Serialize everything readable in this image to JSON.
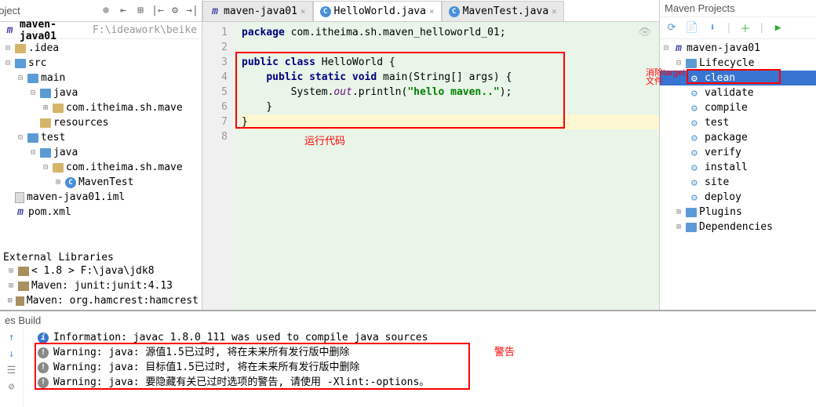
{
  "breadcrumb": {
    "project": "maven-java01",
    "path": "F:\\ideawork\\beike"
  },
  "toolbar": {
    "label": "oject"
  },
  "tree": [
    {
      "indent": 0,
      "exp": "⊟",
      "icon": "folder",
      "label": ".idea"
    },
    {
      "indent": 0,
      "exp": "⊟",
      "icon": "folder-blue",
      "label": "src"
    },
    {
      "indent": 1,
      "exp": "⊟",
      "icon": "folder-blue",
      "label": "main"
    },
    {
      "indent": 2,
      "exp": "⊟",
      "icon": "folder-blue",
      "label": "java"
    },
    {
      "indent": 3,
      "exp": "⊞",
      "icon": "folder",
      "label": "com.itheima.sh.mave"
    },
    {
      "indent": 2,
      "exp": "",
      "icon": "folder",
      "label": "resources"
    },
    {
      "indent": 1,
      "exp": "⊟",
      "icon": "folder-blue",
      "label": "test"
    },
    {
      "indent": 2,
      "exp": "⊟",
      "icon": "folder-blue",
      "label": "java"
    },
    {
      "indent": 3,
      "exp": "⊟",
      "icon": "folder",
      "label": "com.itheima.sh.mave"
    },
    {
      "indent": 4,
      "exp": "⊞",
      "icon": "java",
      "label": "MavenTest"
    },
    {
      "indent": 0,
      "exp": "",
      "icon": "file",
      "label": "maven-java01.iml"
    },
    {
      "indent": 0,
      "exp": "",
      "icon": "m",
      "label": "pom.xml"
    }
  ],
  "external_libs": {
    "title": "External Libraries",
    "items": [
      "< 1.8 >   F:\\java\\jdk8",
      "Maven: junit:junit:4.13",
      "Maven: org.hamcrest:hamcrest"
    ]
  },
  "tabs": [
    {
      "icon": "m",
      "label": "maven-java01",
      "active": false
    },
    {
      "icon": "java",
      "label": "HelloWorld.java",
      "active": true
    },
    {
      "icon": "java",
      "label": "MavenTest.java",
      "active": false
    }
  ],
  "code": {
    "lines": [
      "1",
      "2",
      "3",
      "4",
      "5",
      "6",
      "7",
      "8"
    ],
    "l1_kw": "package",
    "l1_rest": " com.itheima.sh.maven_helloworld_01;",
    "l3_kw": "public class",
    "l3_cls": " HelloWorld ",
    "l3_brace": "{",
    "l4_kw": "public static void",
    "l4_rest": " main(String[] args) {",
    "l5_pre": "        System.",
    "l5_field": "out",
    "l5_mid": ".println(",
    "l5_str": "\"hello maven..\"",
    "l5_end": ");",
    "l6": "    }",
    "l7": "}"
  },
  "annotations": {
    "run_code": "运行代码",
    "warning": "警告",
    "clean_note": "消除target文件"
  },
  "right_panel": {
    "title": "Maven Projects",
    "project": "maven-java01",
    "lifecycle_label": "Lifecycle",
    "lifecycle": [
      "clean",
      "validate",
      "compile",
      "test",
      "package",
      "verify",
      "install",
      "site",
      "deploy"
    ],
    "plugins": "Plugins",
    "deps": "Dependencies"
  },
  "build": {
    "title": "es Build",
    "info": "Information: javac 1.8.0_111 was used to compile java sources",
    "warnings": [
      "Warning: java: 源值1.5已过时, 将在未来所有发行版中删除",
      "Warning: java: 目标值1.5已过时, 将在未来所有发行版中删除",
      "Warning: java: 要隐藏有关已过时选项的警告, 请使用 -Xlint:-options。"
    ]
  }
}
